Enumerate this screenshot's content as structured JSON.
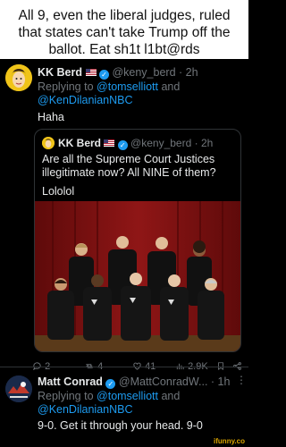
{
  "caption": {
    "line1": "All 9, even the liberal judges, ruled",
    "line2": "that states can't take Trump off the",
    "line3": "ballot. Eat sh1t l1bt@rds"
  },
  "tweet": {
    "author": "KK Berd",
    "handle": "@keny_berd",
    "time": "· 2h",
    "replying_prefix": "Replying to",
    "reply_to_1": "@tomselliott",
    "reply_and": "and",
    "reply_to_2": "@KenDilanianNBC",
    "text": "Haha",
    "quoted": {
      "author": "KK Berd",
      "handle": "@keny_berd",
      "time": "· 2h",
      "text_line1": "Are all the Supreme Court Justices",
      "text_line2": "illegitimate now? All NINE of them?",
      "text_line3": "Lololol"
    },
    "stats": {
      "replies": "2",
      "retweets": "4",
      "likes": "41",
      "views": "2.9K"
    }
  },
  "reply": {
    "author": "Matt Conrad",
    "handle": "@MattConradW...",
    "time": "· 1h",
    "replying_prefix": "Replying to",
    "reply_to_1": "@tomselliott",
    "reply_and": "and",
    "reply_to_2": "@KenDilanianNBC",
    "text": "9-0.  Get it through your head.  9-0"
  },
  "watermark": "ifunny.co",
  "colors": {
    "accent": "#1d9bf0",
    "muted": "#71767b",
    "background": "#000000"
  }
}
